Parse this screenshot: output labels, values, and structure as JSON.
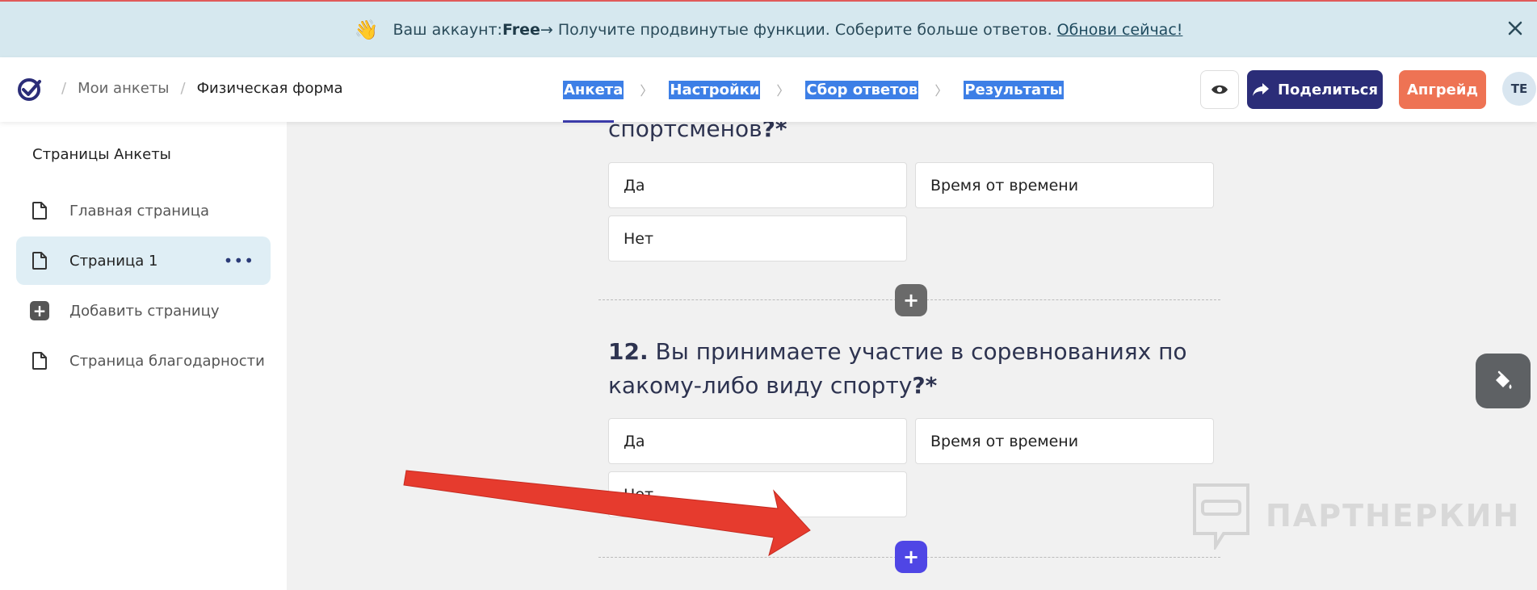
{
  "banner": {
    "prefix": "Ваш аккаунт: ",
    "plan": "Free",
    "text": " → Получите продвинутые функции. Соберите больше ответов.",
    "link": "Обнови сейчас!"
  },
  "header": {
    "breadcrumb": [
      "Мои анкеты",
      "Физическая форма"
    ],
    "steps": [
      "Анкета",
      "Настройки",
      "Сбор ответов",
      "Результаты"
    ],
    "share_label": "Поделиться",
    "upgrade_label": "Апгрейд",
    "avatar_initials": "TE"
  },
  "sidebar": {
    "title": "Страницы Анкеты",
    "items": [
      {
        "label": "Главная страница"
      },
      {
        "label": "Страница 1"
      },
      {
        "label": "Добавить страницу"
      },
      {
        "label": "Страница благодарности"
      }
    ],
    "more": "•••"
  },
  "questions": {
    "q11": {
      "text_tail": "спортсменов",
      "mark": "?*",
      "options": [
        "Да",
        "Время от времени",
        "Нет"
      ]
    },
    "q12": {
      "number": "12.",
      "line1": " Вы принимаете участие в соревнованиях по",
      "line2": "какому-либо виду спорту",
      "mark": "?*",
      "options": [
        "Да",
        "Время от времени",
        "Нет"
      ]
    }
  },
  "watermark": "ПАРТНЕРКИН",
  "colors": {
    "primary": "#2b2d78",
    "upgrade": "#ee7354",
    "add_active": "#4f46e5",
    "arrow": "#e63b2e"
  }
}
